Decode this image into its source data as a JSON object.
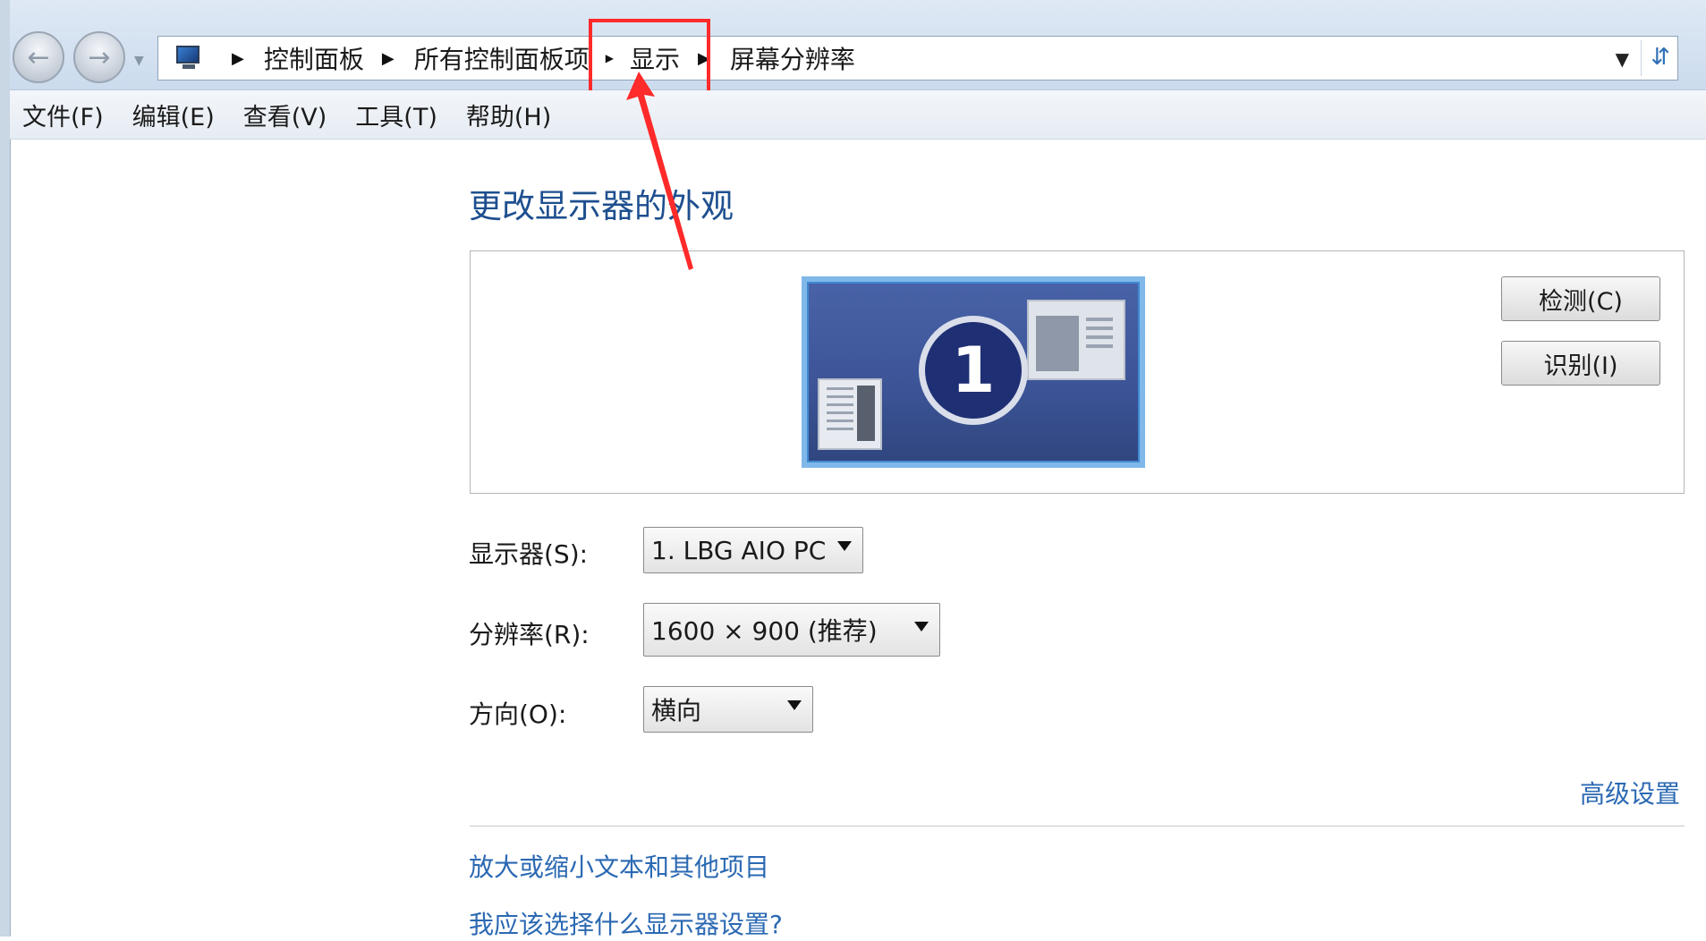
{
  "address_bar": {
    "breadcrumbs": [
      "控制面板",
      "所有控制面板项",
      "显示",
      "屏幕分辨率"
    ]
  },
  "menu": [
    "文件(F)",
    "编辑(E)",
    "查看(V)",
    "工具(T)",
    "帮助(H)"
  ],
  "main": {
    "title": "更改显示器的外观",
    "monitor_number": "1",
    "detect_button": "检测(C)",
    "identify_button": "识别(I)",
    "display_label": "显示器(S):",
    "display_value": "1. LBG AIO PC",
    "resolution_label": "分辨率(R):",
    "resolution_value": "1600 × 900 (推荐)",
    "orientation_label": "方向(O):",
    "orientation_value": "横向",
    "advanced_link": "高级设置",
    "link_text_size": "放大或缩小文本和其他项目",
    "link_which_settings": "我应该选择什么显示器设置?"
  },
  "colors": {
    "title": "#1e4f8f",
    "link": "#2b69b3",
    "annotation": "#ff2a2a"
  },
  "icons": {
    "back": "back-arrow-icon",
    "forward": "forward-arrow-icon",
    "computer": "computer-icon",
    "refresh": "refresh-icon"
  }
}
